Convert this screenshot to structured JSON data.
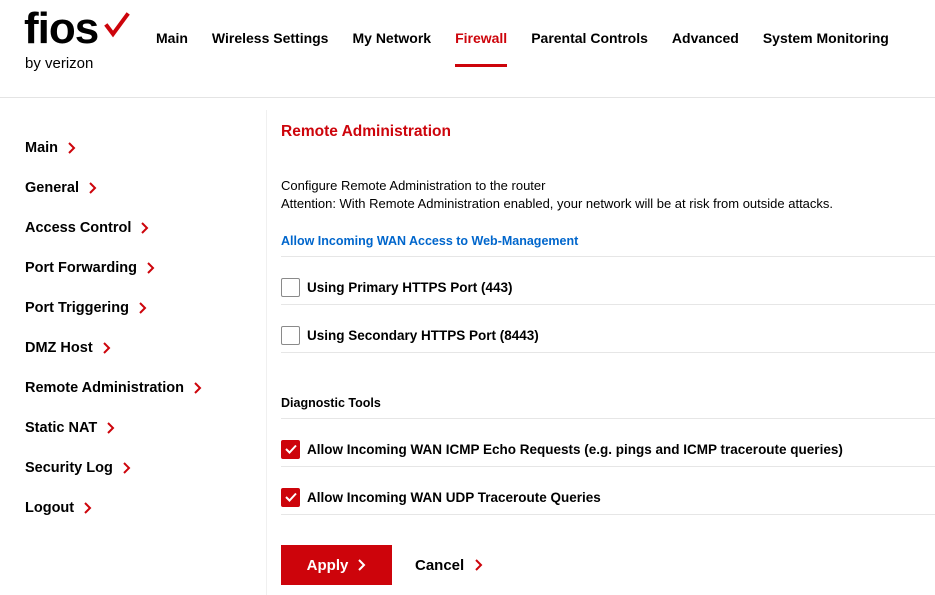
{
  "brand": {
    "logo_word": "fios",
    "logo_sub": "by verizon",
    "accent_color": "#cd040b",
    "link_color": "#0066cc"
  },
  "nav": {
    "items": [
      {
        "label": "Main",
        "active": false
      },
      {
        "label": "Wireless Settings",
        "active": false
      },
      {
        "label": "My Network",
        "active": false
      },
      {
        "label": "Firewall",
        "active": true
      },
      {
        "label": "Parental Controls",
        "active": false
      },
      {
        "label": "Advanced",
        "active": false
      },
      {
        "label": "System Monitoring",
        "active": false
      }
    ]
  },
  "sidebar": {
    "items": [
      {
        "label": "Main"
      },
      {
        "label": "General"
      },
      {
        "label": "Access Control"
      },
      {
        "label": "Port Forwarding"
      },
      {
        "label": "Port Triggering"
      },
      {
        "label": "DMZ Host"
      },
      {
        "label": "Remote Administration"
      },
      {
        "label": "Static NAT"
      },
      {
        "label": "Security Log"
      },
      {
        "label": "Logout"
      }
    ],
    "chevron_icon": "chevron-right-icon"
  },
  "main": {
    "title": "Remote Administration",
    "description": "Configure Remote Administration to the router",
    "attention": "Attention: With Remote Administration enabled, your network will be at risk from outside attacks.",
    "wan_access_link": "Allow Incoming WAN Access to Web-Management",
    "https_options": [
      {
        "label": "Using Primary HTTPS Port (443)",
        "checked": false
      },
      {
        "label": "Using Secondary HTTPS Port (8443)",
        "checked": false
      }
    ],
    "diagnostic_title": "Diagnostic Tools",
    "diagnostic_options": [
      {
        "label": "Allow Incoming WAN ICMP Echo Requests (e.g. pings and ICMP traceroute queries)",
        "checked": true
      },
      {
        "label": "Allow Incoming WAN UDP Traceroute Queries",
        "checked": true
      }
    ],
    "apply_label": "Apply",
    "cancel_label": "Cancel"
  }
}
